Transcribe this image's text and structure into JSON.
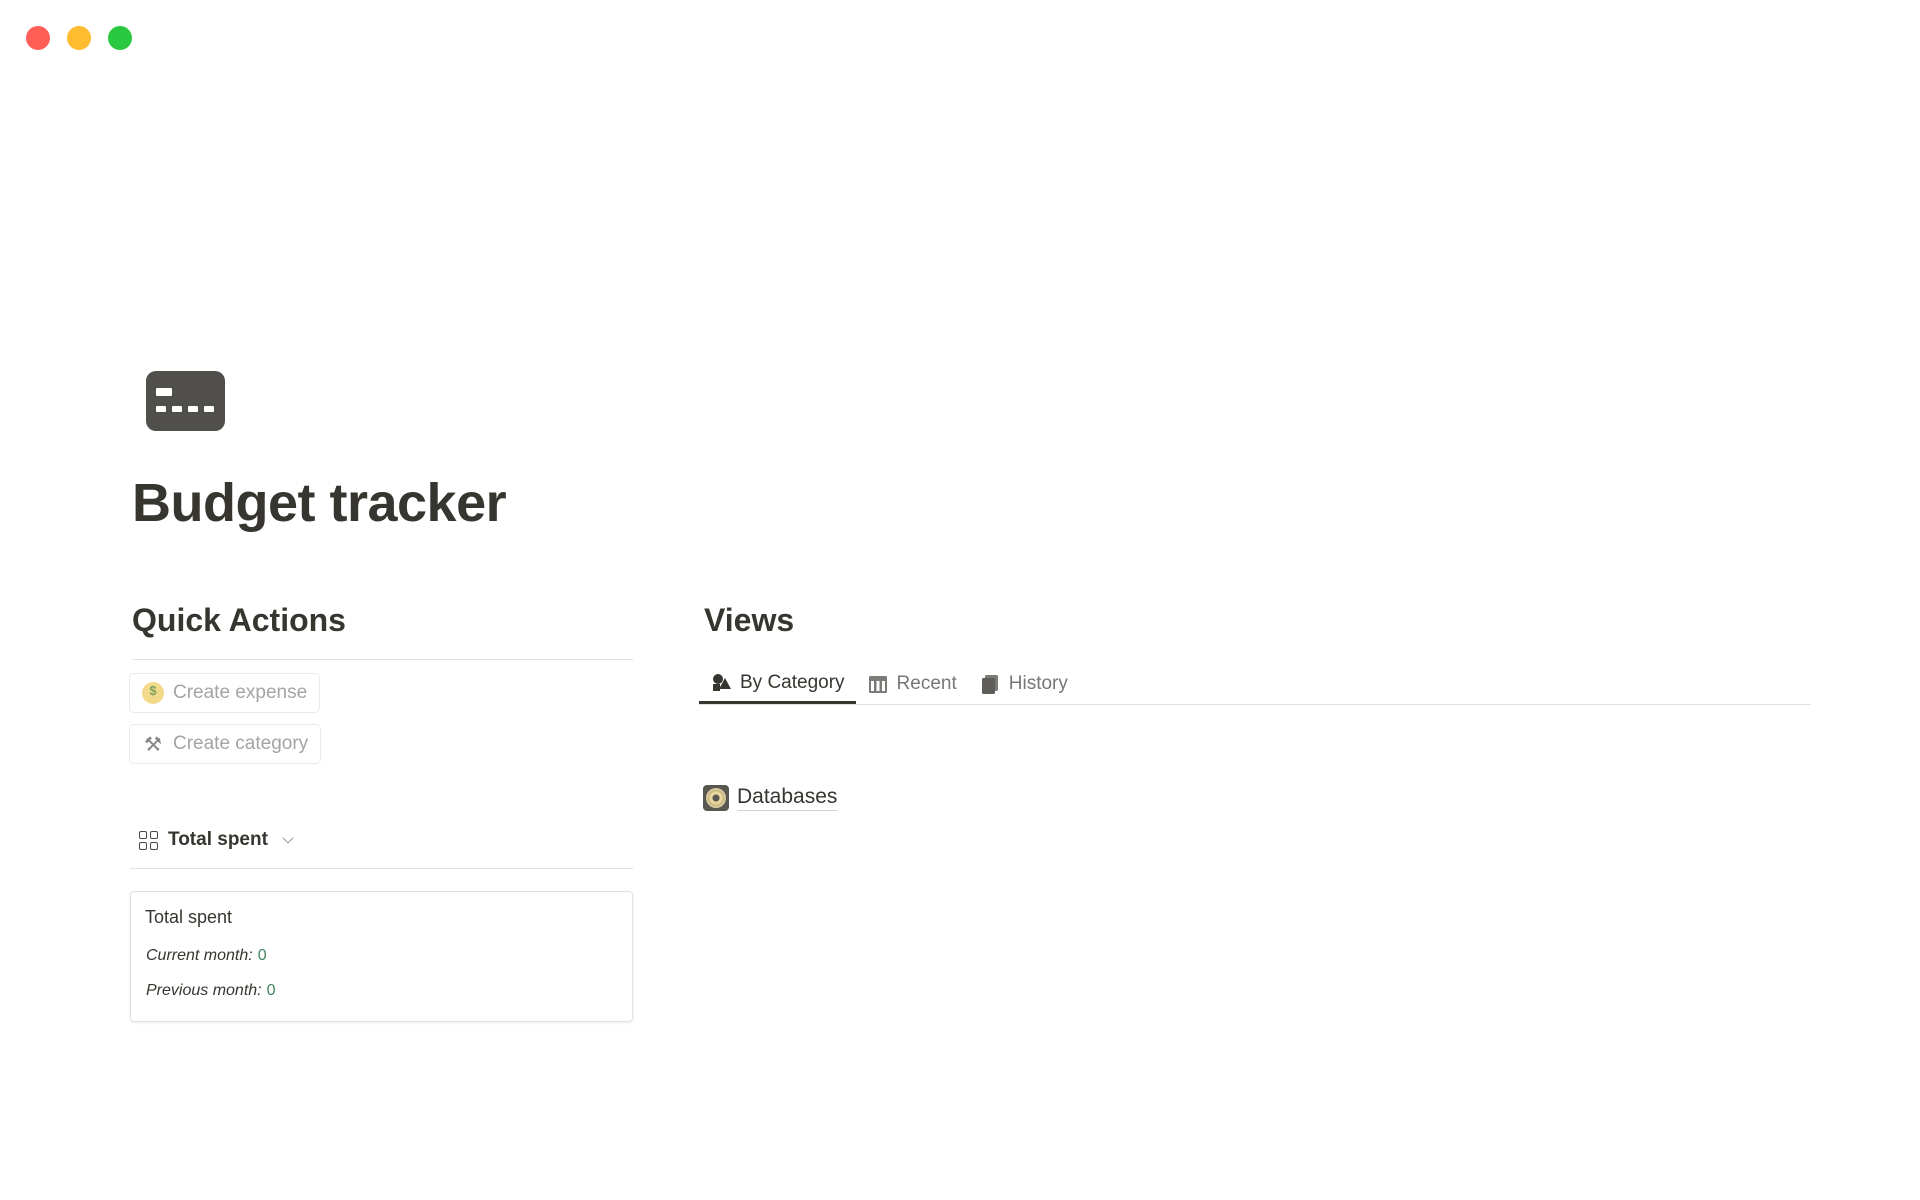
{
  "window": {
    "traffic_lights": {
      "close_color": "#ff5f57",
      "minimize_color": "#febc2e",
      "zoom_color": "#28c840"
    }
  },
  "page": {
    "icon": "credit-card-icon",
    "title": "Budget tracker"
  },
  "quick_actions": {
    "heading": "Quick Actions",
    "buttons": [
      {
        "icon": "money-face-icon",
        "label": "Create expense"
      },
      {
        "icon": "hammer-icon",
        "label": "Create category"
      }
    ]
  },
  "total_spent": {
    "view_selector": {
      "icon": "gallery-grid-icon",
      "label": "Total spent"
    },
    "card": {
      "title": "Total spent",
      "current_month_label": "Current month:",
      "current_month_value": "0",
      "previous_month_label": "Previous month:",
      "previous_month_value": "0"
    }
  },
  "views": {
    "heading": "Views",
    "tabs": [
      {
        "icon": "shapes-icon",
        "label": "By Category",
        "active": true
      },
      {
        "icon": "calendar-icon",
        "label": "Recent",
        "active": false
      },
      {
        "icon": "book-icon",
        "label": "History",
        "active": false
      }
    ],
    "databases_link": {
      "icon": "disk-icon",
      "label": "Databases"
    }
  },
  "colors": {
    "text": "#37352f",
    "muted": "#787774",
    "value_green": "#448361",
    "divider": "#e3e2df"
  }
}
